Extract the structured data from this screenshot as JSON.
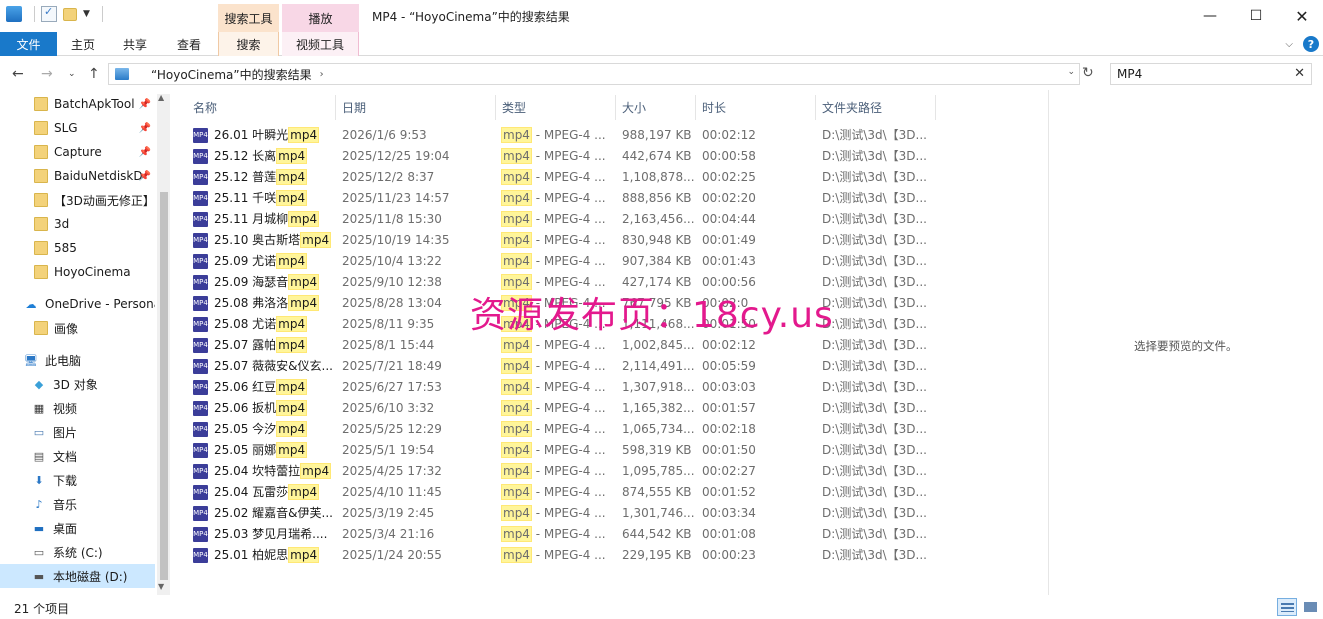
{
  "window": {
    "title": "MP4 - “HoyoCinema”中的搜索结果",
    "contextual_tabs": {
      "search_tools": "搜索工具",
      "play": "播放"
    }
  },
  "ribbon": {
    "tabs": [
      "文件",
      "主页",
      "共享",
      "查看",
      "搜索",
      "视频工具"
    ]
  },
  "address": {
    "path": "“HoyoCinema”中的搜索结果",
    "search_value": "MP4"
  },
  "nav": {
    "quick_access": [
      {
        "label": "BatchApkTool",
        "pinned": true
      },
      {
        "label": "SLG",
        "pinned": true
      },
      {
        "label": "Capture",
        "pinned": true
      },
      {
        "label": "BaiduNetdiskD",
        "pinned": true
      },
      {
        "label": "【3D动画无修正】",
        "pinned": false
      },
      {
        "label": "3d",
        "pinned": false
      },
      {
        "label": "585",
        "pinned": false
      },
      {
        "label": "HoyoCinema",
        "pinned": false
      }
    ],
    "onedrive": "OneDrive - Persona",
    "onedrive_child": "画像",
    "this_pc": "此电脑",
    "pc_items": [
      {
        "label": "3D 对象",
        "icon": "3d-objects-icon"
      },
      {
        "label": "视频",
        "icon": "videos-icon"
      },
      {
        "label": "图片",
        "icon": "pictures-icon"
      },
      {
        "label": "文档",
        "icon": "documents-icon"
      },
      {
        "label": "下载",
        "icon": "downloads-icon"
      },
      {
        "label": "音乐",
        "icon": "music-icon"
      },
      {
        "label": "桌面",
        "icon": "desktop-icon"
      },
      {
        "label": "系统 (C:)",
        "icon": "drive-c-icon"
      },
      {
        "label": "本地磁盘 (D:)",
        "icon": "drive-d-icon"
      }
    ]
  },
  "columns": [
    "名称",
    "日期",
    "类型",
    "大小",
    "时长",
    "文件夹路径"
  ],
  "files": [
    {
      "name": "26.01 叶瞬光",
      "ext": "mp4",
      "date": "2026/1/6 9:53",
      "type_ext": "mp4",
      "type": " - MPEG-4 ...",
      "size": "988,197 KB",
      "duration": "00:02:12",
      "path": "D:\\测试\\3d\\【3D..."
    },
    {
      "name": "25.12 长离",
      "ext": "mp4",
      "date": "2025/12/25 19:04",
      "type_ext": "mp4",
      "type": " - MPEG-4 ...",
      "size": "442,674 KB",
      "duration": "00:00:58",
      "path": "D:\\测试\\3d\\【3D..."
    },
    {
      "name": "25.12 普莲",
      "ext": "mp4",
      "date": "2025/12/2 8:37",
      "type_ext": "mp4",
      "type": " - MPEG-4 ...",
      "size": "1,108,878...",
      "duration": "00:02:25",
      "path": "D:\\测试\\3d\\【3D..."
    },
    {
      "name": "25.11 千咲",
      "ext": "mp4",
      "date": "2025/11/23 14:57",
      "type_ext": "mp4",
      "type": " - MPEG-4 ...",
      "size": "888,856 KB",
      "duration": "00:02:20",
      "path": "D:\\测试\\3d\\【3D..."
    },
    {
      "name": "25.11 月城柳",
      "ext": "mp4",
      "date": "2025/11/8 15:30",
      "type_ext": "mp4",
      "type": " - MPEG-4 ...",
      "size": "2,163,456...",
      "duration": "00:04:44",
      "path": "D:\\测试\\3d\\【3D..."
    },
    {
      "name": "25.10 奥古斯塔",
      "ext": "mp4",
      "date": "2025/10/19 14:35",
      "type_ext": "mp4",
      "type": " - MPEG-4 ...",
      "size": "830,948 KB",
      "duration": "00:01:49",
      "path": "D:\\测试\\3d\\【3D..."
    },
    {
      "name": "25.09 尤诺",
      "ext": "mp4",
      "date": "2025/10/4 13:22",
      "type_ext": "mp4",
      "type": " - MPEG-4 ...",
      "size": "907,384 KB",
      "duration": "00:01:43",
      "path": "D:\\测试\\3d\\【3D..."
    },
    {
      "name": "25.09 海瑟音",
      "ext": "mp4",
      "date": "2025/9/10 12:38",
      "type_ext": "mp4",
      "type": " - MPEG-4 ...",
      "size": "427,174 KB",
      "duration": "00:00:56",
      "path": "D:\\测试\\3d\\【3D..."
    },
    {
      "name": "25.08 弗洛洛",
      "ext": "mp4",
      "date": "2025/8/28 13:04",
      "type_ext": "mp4",
      "type": " - MPEG-4 ...",
      "size": "767,795 KB",
      "duration": "00:02:0",
      "path": "D:\\测试\\3d\\【3D..."
    },
    {
      "name": "25.08 尤诺",
      "ext": "mp4",
      "date": "2025/8/11 9:35",
      "type_ext": "mp4",
      "type": " - MPEG-4 ...",
      "size": "1,111,468...",
      "duration": "00:01:50",
      "path": "D:\\测试\\3d\\【3D..."
    },
    {
      "name": "25.07 露帕",
      "ext": "mp4",
      "date": "2025/8/1 15:44",
      "type_ext": "mp4",
      "type": " - MPEG-4 ...",
      "size": "1,002,845...",
      "duration": "00:02:12",
      "path": "D:\\测试\\3d\\【3D..."
    },
    {
      "name": "25.07 薇薇安&仪玄...",
      "ext": "",
      "date": "2025/7/21 18:49",
      "type_ext": "mp4",
      "type": " - MPEG-4 ...",
      "size": "2,114,491...",
      "duration": "00:05:59",
      "path": "D:\\测试\\3d\\【3D..."
    },
    {
      "name": "25.06 红豆",
      "ext": "mp4",
      "date": "2025/6/27 17:53",
      "type_ext": "mp4",
      "type": " - MPEG-4 ...",
      "size": "1,307,918...",
      "duration": "00:03:03",
      "path": "D:\\测试\\3d\\【3D..."
    },
    {
      "name": "25.06 扳机",
      "ext": "mp4",
      "date": "2025/6/10 3:32",
      "type_ext": "mp4",
      "type": " - MPEG-4 ...",
      "size": "1,165,382...",
      "duration": "00:01:57",
      "path": "D:\\测试\\3d\\【3D..."
    },
    {
      "name": "25.05 今汐",
      "ext": "mp4",
      "date": "2025/5/25 12:29",
      "type_ext": "mp4",
      "type": " - MPEG-4 ...",
      "size": "1,065,734...",
      "duration": "00:02:18",
      "path": "D:\\测试\\3d\\【3D..."
    },
    {
      "name": "25.05 丽娜",
      "ext": "mp4",
      "date": "2025/5/1 19:54",
      "type_ext": "mp4",
      "type": " - MPEG-4 ...",
      "size": "598,319 KB",
      "duration": "00:01:50",
      "path": "D:\\测试\\3d\\【3D..."
    },
    {
      "name": "25.04 坎特蕾拉",
      "ext": "mp4",
      "date": "2025/4/25 17:32",
      "type_ext": "mp4",
      "type": " - MPEG-4 ...",
      "size": "1,095,785...",
      "duration": "00:02:27",
      "path": "D:\\测试\\3d\\【3D..."
    },
    {
      "name": "25.04 瓦雷莎",
      "ext": "mp4",
      "date": "2025/4/10 11:45",
      "type_ext": "mp4",
      "type": " - MPEG-4 ...",
      "size": "874,555 KB",
      "duration": "00:01:52",
      "path": "D:\\测试\\3d\\【3D..."
    },
    {
      "name": "25.02 耀嘉音&伊芙...",
      "ext": "",
      "date": "2025/3/19 2:45",
      "type_ext": "mp4",
      "type": " - MPEG-4 ...",
      "size": "1,301,746...",
      "duration": "00:03:34",
      "path": "D:\\测试\\3d\\【3D..."
    },
    {
      "name": "25.03 梦见月瑞希....",
      "ext": "",
      "date": "2025/3/4 21:16",
      "type_ext": "mp4",
      "type": " - MPEG-4 ...",
      "size": "644,542 KB",
      "duration": "00:01:08",
      "path": "D:\\测试\\3d\\【3D..."
    },
    {
      "name": "25.01 柏妮思",
      "ext": "mp4",
      "date": "2025/1/24 20:55",
      "type_ext": "mp4",
      "type": " - MPEG-4 ...",
      "size": "229,195 KB",
      "duration": "00:00:23",
      "path": "D:\\测试\\3d\\【3D..."
    }
  ],
  "preview_text": "选择要预览的文件。",
  "watermark": "资源发布页：18cy.us",
  "status": {
    "item_count": "21 个项目"
  },
  "colors": {
    "accent": "#1979ca",
    "highlight": "#fff59a",
    "watermark": "#e3198d",
    "selected": "#cce8ff"
  }
}
